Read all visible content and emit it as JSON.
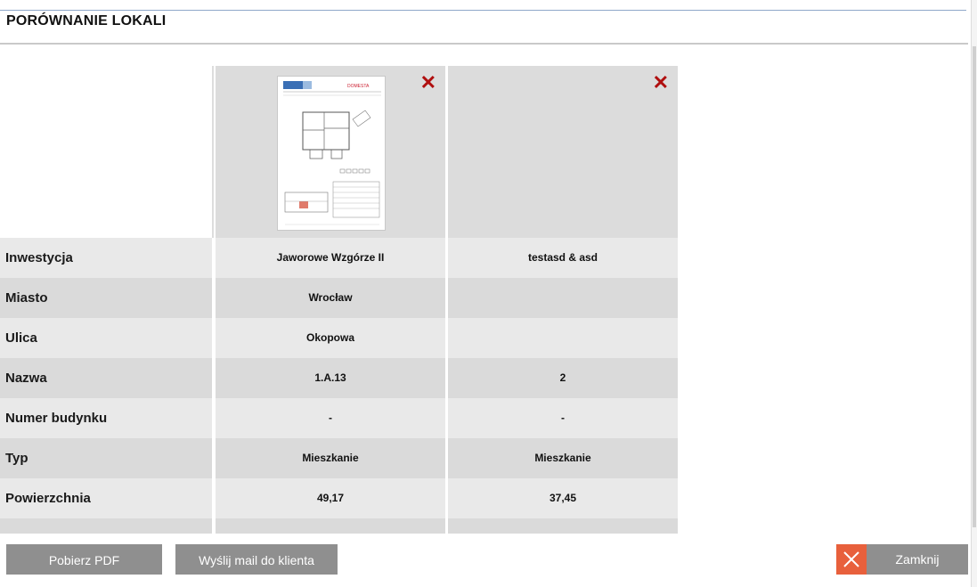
{
  "page": {
    "title": "PORÓWNANIE LOKALI"
  },
  "columns": [
    {
      "id": "col1",
      "has_image": true,
      "logo_text": "DOMESTA",
      "remove_glyph": "✕"
    },
    {
      "id": "col2",
      "has_image": false,
      "remove_glyph": "✕"
    }
  ],
  "rows": [
    {
      "label": "Inwestycja",
      "values": [
        "Jaworowe Wzgórze II",
        "testasd & asd"
      ]
    },
    {
      "label": "Miasto",
      "values": [
        "Wrocław",
        ""
      ]
    },
    {
      "label": "Ulica",
      "values": [
        "Okopowa",
        ""
      ]
    },
    {
      "label": "Nazwa",
      "values": [
        "1.A.13",
        "2"
      ]
    },
    {
      "label": "Numer budynku",
      "values": [
        "-",
        "-"
      ]
    },
    {
      "label": "Typ",
      "values": [
        "Mieszkanie",
        "Mieszkanie"
      ]
    },
    {
      "label": "Powierzchnia",
      "values": [
        "49,17",
        "37,45"
      ]
    },
    {
      "label": "",
      "values": [
        "",
        ""
      ]
    }
  ],
  "actions": {
    "download_pdf": "Pobierz PDF",
    "send_mail": "Wyślij mail do klienta",
    "close": "Zamknij"
  },
  "icons": {
    "remove": "close-x-icon",
    "close": "close-icon"
  },
  "colors": {
    "remove_red": "#b00f0f",
    "close_accent": "#e8603c",
    "button_gray": "#8f8f8f"
  }
}
